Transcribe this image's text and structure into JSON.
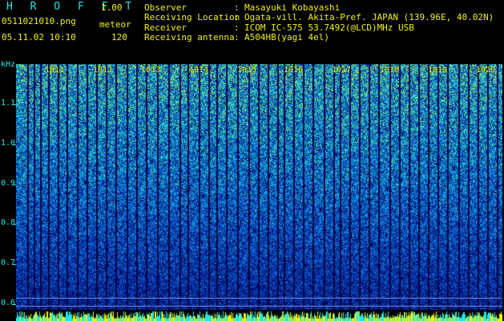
{
  "header": {
    "app_title": "H R O F F T",
    "version": "1.00",
    "filename": "0511021010.png",
    "meteor_label": "meteor",
    "datetime": "05.11.02 10:10",
    "meteor_count": "120"
  },
  "info": {
    "observer_label": "Observer",
    "observer_value": "Masayuki Kobayashi",
    "location_label": "Receiving Location",
    "location_value": "Ogata-vill. Akita-Pref. JAPAN (139.96E, 40.02N)",
    "receiver_label": "Receiver",
    "receiver_value": "ICOM IC-575 53.7492(@LCD)MHz USB",
    "antenna_label": "Receiving antenna",
    "antenna_value": "A504HB(yagi 4el)",
    "separator": ":"
  },
  "spectrogram": {
    "y_unit": "kHz",
    "y_ticks": [
      "1.1",
      "1.0",
      "0.9",
      "0.8",
      "0.7",
      "0.6"
    ],
    "x_ticks": [
      "1011",
      "1012",
      "1013",
      "1014",
      "1015",
      "1016",
      "1017",
      "1018",
      "1019",
      "1020"
    ]
  },
  "colors": {
    "label_cyan": "#1fe8e8",
    "value_yellow": "#f2f200",
    "background": "#000000",
    "spectro_low": "#061a5c",
    "spectro_mid": "#1f5fd6",
    "spectro_high": "#2fe0a0"
  }
}
